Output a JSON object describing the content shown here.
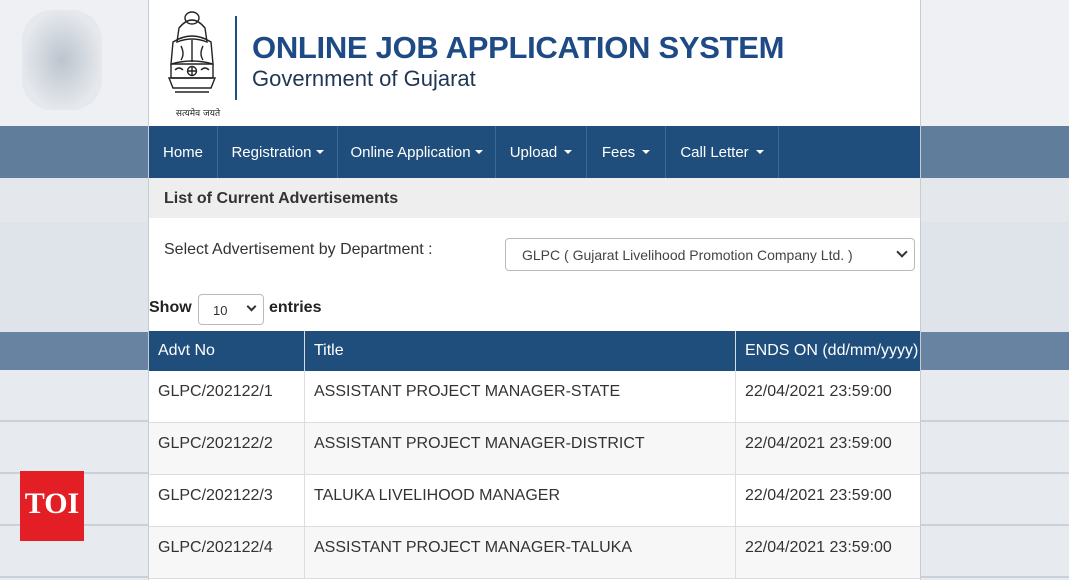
{
  "header": {
    "title": "ONLINE JOB APPLICATION SYSTEM",
    "subtitle": "Government of Gujarat",
    "emblem_motto": "सत्यमेव जयते"
  },
  "nav": {
    "items": [
      {
        "label": "Home",
        "dropdown": false
      },
      {
        "label": "Registration",
        "dropdown": true
      },
      {
        "label": "Online Application",
        "dropdown": true
      },
      {
        "label": "Upload",
        "dropdown": true
      },
      {
        "label": "Fees",
        "dropdown": true
      },
      {
        "label": "Call Letter",
        "dropdown": true
      }
    ]
  },
  "section": {
    "heading": "List of Current Advertisements"
  },
  "filter": {
    "label": "Select Advertisement by Department :",
    "selected": "GLPC ( Gujarat Livelihood Promotion Company Ltd. )"
  },
  "length": {
    "show_label": "Show",
    "value": "10",
    "entries_label": "entries"
  },
  "table": {
    "headers": [
      "Advt No",
      "Title",
      "ENDS ON (dd/mm/yyyy)"
    ],
    "rows": [
      [
        "GLPC/202122/1",
        "ASSISTANT PROJECT MANAGER-STATE",
        "22/04/2021 23:59:00"
      ],
      [
        "GLPC/202122/2",
        "ASSISTANT PROJECT MANAGER-DISTRICT",
        "22/04/2021 23:59:00"
      ],
      [
        "GLPC/202122/3",
        "TALUKA LIVELIHOOD MANAGER",
        "22/04/2021 23:59:00"
      ],
      [
        "GLPC/202122/4",
        "ASSISTANT PROJECT MANAGER-TALUKA",
        "22/04/2021 23:59:00"
      ]
    ]
  },
  "watermark": {
    "label": "TOI"
  },
  "colors": {
    "nav_bg": "#1f4e7d",
    "title_blue": "#1e4a86",
    "watermark_red": "#e31e24"
  }
}
